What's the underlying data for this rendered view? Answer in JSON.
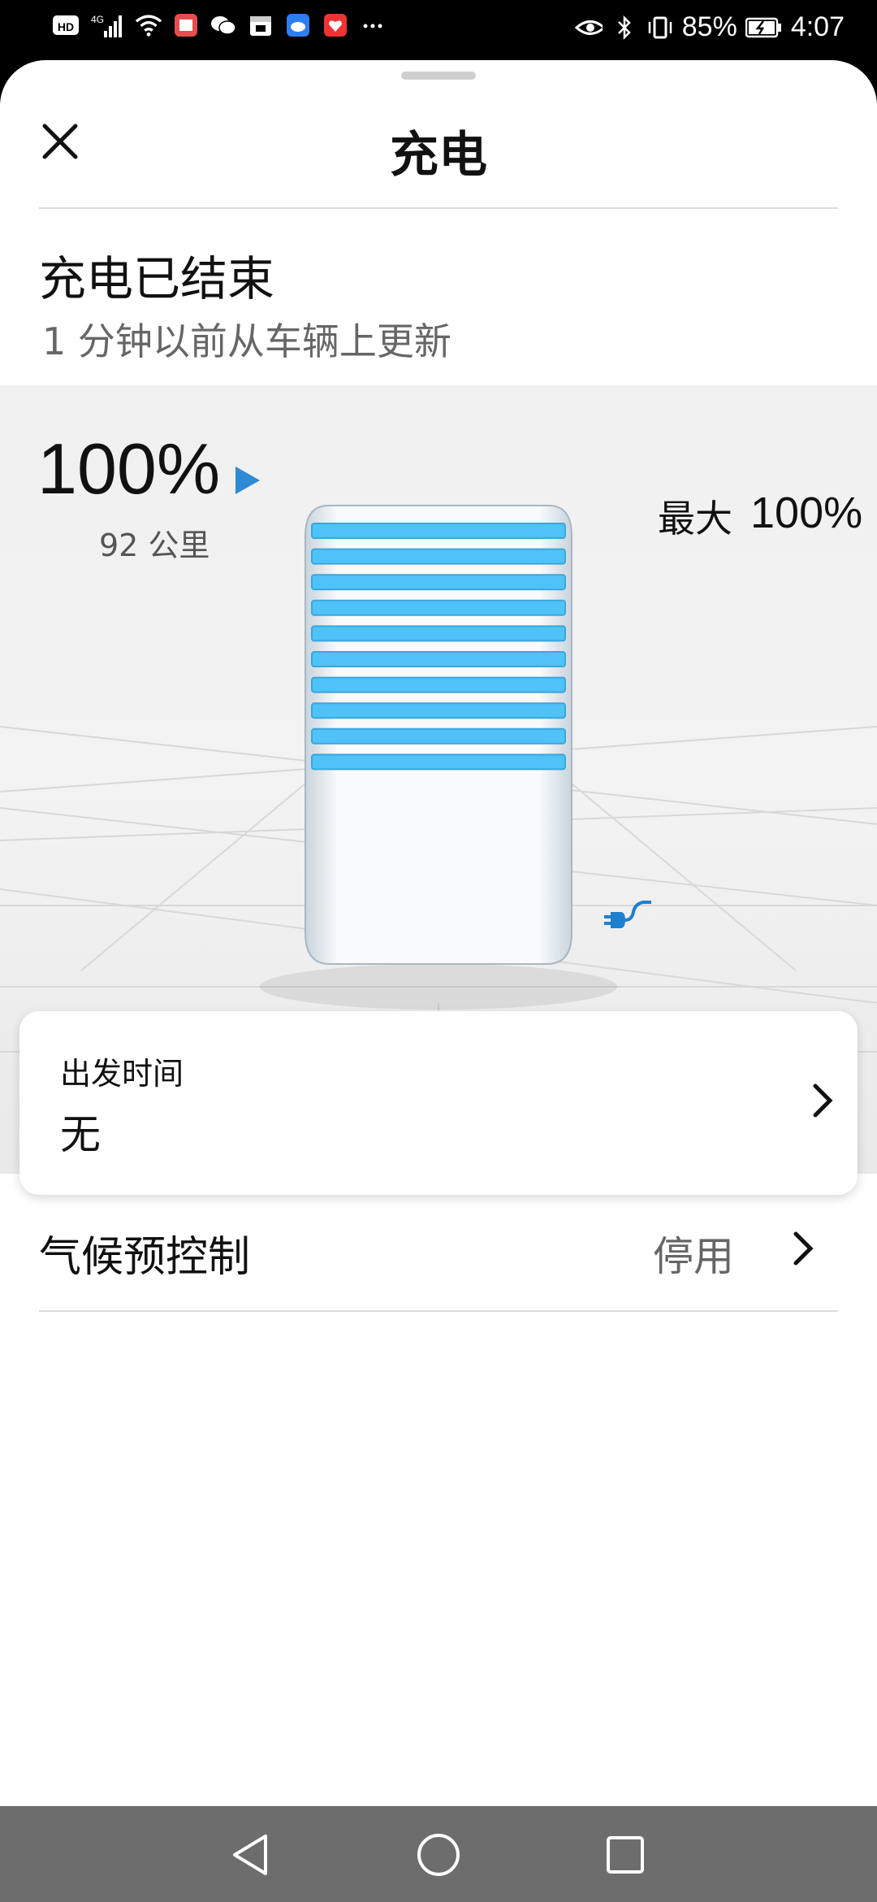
{
  "status_bar": {
    "signal_type": "4G",
    "battery": "85%",
    "time": "4:07",
    "icons": [
      "hd-icon",
      "signal-icon",
      "wifi-icon",
      "book-app-icon",
      "wechat-icon",
      "calendar-icon",
      "cloud-icon",
      "app-icon",
      "more-icon",
      "eye-icon",
      "bluetooth-icon",
      "vibrate-icon",
      "battery-icon"
    ]
  },
  "header": {
    "title": "充电",
    "close_icon": "close-icon"
  },
  "charging_status": {
    "title": "充电已结束",
    "subtitle": "1 分钟以前从车辆上更新"
  },
  "battery": {
    "percent": "100%",
    "range": "92 公里",
    "max_label": "最大",
    "max_value": "100%",
    "level": 1.0,
    "bars": 10,
    "bar_color": "#4fc3f7",
    "play_color": "#2f8ad6",
    "plug_color": "#1f7fcf"
  },
  "departure": {
    "label": "出发时间",
    "value": "无"
  },
  "climate": {
    "label": "气候预控制",
    "value": "停用"
  },
  "nav": {
    "back_icon": "back-icon",
    "home_icon": "home-icon",
    "recents_icon": "recents-icon"
  }
}
